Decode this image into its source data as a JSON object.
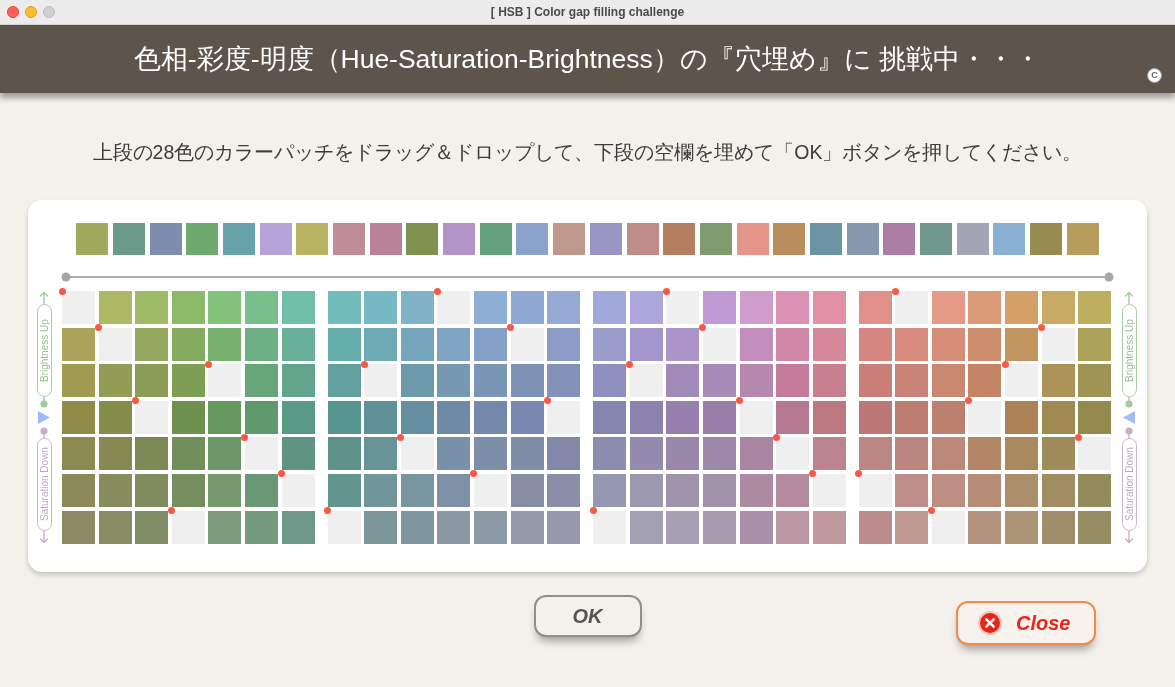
{
  "window": {
    "title": "[ HSB ] Color gap filling challenge"
  },
  "header": {
    "title": "色相-彩度-明度（Hue-Saturation-Brightness）の『穴埋め』に 挑戦中・・・",
    "badge": "C"
  },
  "instruction": "上段の28色のカラーパッチをドラッグ＆ドロップして、下段の空欄を埋めて「OK」ボタンを押してください。",
  "palette": [
    {
      "color": "#a0aa5e"
    },
    {
      "color": "#6a9a8a"
    },
    {
      "color": "#7e8cb0"
    },
    {
      "color": "#6eaa70"
    },
    {
      "color": "#68a2aa"
    },
    {
      "color": "#b4a2d8"
    },
    {
      "color": "#b8b462"
    },
    {
      "color": "#be8c94"
    },
    {
      "color": "#b88298"
    },
    {
      "color": "#7c924e"
    },
    {
      "color": "#b294c8"
    },
    {
      "color": "#64a07c"
    },
    {
      "color": "#8aa2ca"
    },
    {
      "color": "#be988c"
    },
    {
      "color": "#9a94c4"
    },
    {
      "color": "#be8c8a"
    },
    {
      "color": "#b47e60"
    },
    {
      "color": "#7e9a6e"
    },
    {
      "color": "#e4968a"
    },
    {
      "color": "#b88e5c"
    },
    {
      "color": "#6c94a4"
    },
    {
      "color": "#8698ae"
    },
    {
      "color": "#ac7ea6"
    },
    {
      "color": "#70988e"
    },
    {
      "color": "#a4a4b4"
    },
    {
      "color": "#8ab0d4"
    },
    {
      "color": "#968c50"
    },
    {
      "color": "#b89e5c"
    }
  ],
  "left_axis": {
    "upper": "Brightness Up",
    "lower": "Saturation Down"
  },
  "right_axis": {
    "upper": "Brightness Up",
    "lower": "Saturation Down"
  },
  "grid": {
    "blocks": [
      {
        "rows": [
          [
            {
              "kind": "empty"
            },
            {
              "kind": "patch",
              "color": "#adb865"
            },
            {
              "kind": "patch",
              "color": "#9fba65"
            },
            {
              "kind": "patch",
              "color": "#8dba68"
            },
            {
              "kind": "patch",
              "color": "#82c27a"
            },
            {
              "kind": "patch",
              "color": "#77c08c"
            },
            {
              "kind": "patch",
              "color": "#6fc0a6"
            }
          ],
          [
            {
              "kind": "patch",
              "color": "#aba45a"
            },
            {
              "kind": "empty"
            },
            {
              "kind": "patch",
              "color": "#93a85c"
            },
            {
              "kind": "patch",
              "color": "#85ab60"
            },
            {
              "kind": "patch",
              "color": "#78b070"
            },
            {
              "kind": "patch",
              "color": "#6db083"
            },
            {
              "kind": "patch",
              "color": "#68b09a"
            }
          ],
          [
            {
              "kind": "patch",
              "color": "#a09a52"
            },
            {
              "kind": "patch",
              "color": "#929c52"
            },
            {
              "kind": "patch",
              "color": "#8a9c55"
            },
            {
              "kind": "patch",
              "color": "#7c9e55"
            },
            {
              "kind": "empty"
            },
            {
              "kind": "patch",
              "color": "#66a678"
            },
            {
              "kind": "patch",
              "color": "#62a48c"
            }
          ],
          [
            {
              "kind": "patch",
              "color": "#8e8a48"
            },
            {
              "kind": "patch",
              "color": "#848c4a"
            },
            {
              "kind": "empty"
            },
            {
              "kind": "patch",
              "color": "#6e9150"
            },
            {
              "kind": "patch",
              "color": "#66985f"
            },
            {
              "kind": "patch",
              "color": "#5e9a6e"
            },
            {
              "kind": "patch",
              "color": "#589a86"
            }
          ],
          [
            {
              "kind": "patch",
              "color": "#8c8a50"
            },
            {
              "kind": "patch",
              "color": "#868a52"
            },
            {
              "kind": "patch",
              "color": "#7e8a56"
            },
            {
              "kind": "patch",
              "color": "#728e5a"
            },
            {
              "kind": "patch",
              "color": "#6c9668"
            },
            {
              "kind": "empty"
            },
            {
              "kind": "patch",
              "color": "#609482"
            }
          ],
          [
            {
              "kind": "patch",
              "color": "#8c8a5a"
            },
            {
              "kind": "patch",
              "color": "#868c5c"
            },
            {
              "kind": "patch",
              "color": "#808c5e"
            },
            {
              "kind": "patch",
              "color": "#768e5e"
            },
            {
              "kind": "patch",
              "color": "#76986e"
            },
            {
              "kind": "patch",
              "color": "#6a9876"
            },
            {
              "kind": "empty"
            }
          ],
          [
            {
              "kind": "patch",
              "color": "#8c8a62"
            },
            {
              "kind": "patch",
              "color": "#888c64"
            },
            {
              "kind": "patch",
              "color": "#808e66"
            },
            {
              "kind": "empty"
            },
            {
              "kind": "patch",
              "color": "#7c9a7a"
            },
            {
              "kind": "patch",
              "color": "#749a80"
            },
            {
              "kind": "patch",
              "color": "#70988a"
            }
          ]
        ]
      },
      {
        "rows": [
          [
            {
              "kind": "patch",
              "color": "#72bcbc"
            },
            {
              "kind": "patch",
              "color": "#76b8c4"
            },
            {
              "kind": "patch",
              "color": "#80b2c8"
            },
            {
              "kind": "empty"
            },
            {
              "kind": "patch",
              "color": "#8eaed4"
            },
            {
              "kind": "patch",
              "color": "#90a8d4"
            },
            {
              "kind": "patch",
              "color": "#96a8d4"
            }
          ],
          [
            {
              "kind": "patch",
              "color": "#66aeac"
            },
            {
              "kind": "patch",
              "color": "#6eaab4"
            },
            {
              "kind": "patch",
              "color": "#76a6bc"
            },
            {
              "kind": "patch",
              "color": "#80a4c4"
            },
            {
              "kind": "patch",
              "color": "#84a0c6"
            },
            {
              "kind": "empty"
            },
            {
              "kind": "patch",
              "color": "#8c9cc6"
            }
          ],
          [
            {
              "kind": "patch",
              "color": "#62a0a0"
            },
            {
              "kind": "empty"
            },
            {
              "kind": "patch",
              "color": "#6c9aaa"
            },
            {
              "kind": "patch",
              "color": "#7698b2"
            },
            {
              "kind": "patch",
              "color": "#7a96b6"
            },
            {
              "kind": "patch",
              "color": "#7e92b6"
            },
            {
              "kind": "patch",
              "color": "#8492ba"
            }
          ],
          [
            {
              "kind": "patch",
              "color": "#579690"
            },
            {
              "kind": "patch",
              "color": "#5e9298"
            },
            {
              "kind": "patch",
              "color": "#658fa0"
            },
            {
              "kind": "patch",
              "color": "#6e8aa6"
            },
            {
              "kind": "patch",
              "color": "#7488aa"
            },
            {
              "kind": "patch",
              "color": "#7787ad"
            },
            {
              "kind": "empty"
            }
          ],
          [
            {
              "kind": "patch",
              "color": "#5e9288"
            },
            {
              "kind": "patch",
              "color": "#689496"
            },
            {
              "kind": "empty"
            },
            {
              "kind": "patch",
              "color": "#7890a8"
            },
            {
              "kind": "patch",
              "color": "#7c8ea8"
            },
            {
              "kind": "patch",
              "color": "#7e8ca6"
            },
            {
              "kind": "patch",
              "color": "#8488a8"
            }
          ],
          [
            {
              "kind": "patch",
              "color": "#64948e"
            },
            {
              "kind": "patch",
              "color": "#70969a"
            },
            {
              "kind": "patch",
              "color": "#7896a0"
            },
            {
              "kind": "patch",
              "color": "#7e90a6"
            },
            {
              "kind": "empty"
            },
            {
              "kind": "patch",
              "color": "#888ea4"
            },
            {
              "kind": "patch",
              "color": "#8c8ea8"
            }
          ],
          [
            {
              "kind": "empty"
            },
            {
              "kind": "patch",
              "color": "#7a9698"
            },
            {
              "kind": "patch",
              "color": "#8096a0"
            },
            {
              "kind": "patch",
              "color": "#8a98a4"
            },
            {
              "kind": "patch",
              "color": "#8c9aa6"
            },
            {
              "kind": "patch",
              "color": "#9498a8"
            },
            {
              "kind": "patch",
              "color": "#9898ac"
            }
          ]
        ]
      },
      {
        "rows": [
          [
            {
              "kind": "patch",
              "color": "#a0a8dc"
            },
            {
              "kind": "patch",
              "color": "#aca6dc"
            },
            {
              "kind": "empty"
            },
            {
              "kind": "patch",
              "color": "#c09ad4"
            },
            {
              "kind": "patch",
              "color": "#d09ccc"
            },
            {
              "kind": "patch",
              "color": "#dc90b4"
            },
            {
              "kind": "patch",
              "color": "#e290a4"
            }
          ],
          [
            {
              "kind": "patch",
              "color": "#9a9ccc"
            },
            {
              "kind": "patch",
              "color": "#a296cc"
            },
            {
              "kind": "patch",
              "color": "#aa94c8"
            },
            {
              "kind": "empty"
            },
            {
              "kind": "patch",
              "color": "#c28cbc"
            },
            {
              "kind": "patch",
              "color": "#d086a4"
            },
            {
              "kind": "patch",
              "color": "#d48898"
            }
          ],
          [
            {
              "kind": "patch",
              "color": "#8e90c0"
            },
            {
              "kind": "empty"
            },
            {
              "kind": "patch",
              "color": "#a08ab8"
            },
            {
              "kind": "patch",
              "color": "#a68ab8"
            },
            {
              "kind": "patch",
              "color": "#b688b0"
            },
            {
              "kind": "patch",
              "color": "#c47c9a"
            },
            {
              "kind": "patch",
              "color": "#c8808e"
            }
          ],
          [
            {
              "kind": "patch",
              "color": "#8486b0"
            },
            {
              "kind": "patch",
              "color": "#8c82b0"
            },
            {
              "kind": "patch",
              "color": "#9680ae"
            },
            {
              "kind": "patch",
              "color": "#9a7ea8"
            },
            {
              "kind": "empty"
            },
            {
              "kind": "patch",
              "color": "#b47890"
            },
            {
              "kind": "patch",
              "color": "#bc7880"
            }
          ],
          [
            {
              "kind": "patch",
              "color": "#8c8cb0"
            },
            {
              "kind": "patch",
              "color": "#948aae"
            },
            {
              "kind": "patch",
              "color": "#9a88aa"
            },
            {
              "kind": "patch",
              "color": "#9c88a8"
            },
            {
              "kind": "patch",
              "color": "#a886a2"
            },
            {
              "kind": "empty"
            },
            {
              "kind": "patch",
              "color": "#bc848e"
            }
          ],
          [
            {
              "kind": "patch",
              "color": "#9498b0"
            },
            {
              "kind": "patch",
              "color": "#9c98b0"
            },
            {
              "kind": "patch",
              "color": "#a094ac"
            },
            {
              "kind": "patch",
              "color": "#a292aa"
            },
            {
              "kind": "patch",
              "color": "#ac8aa2"
            },
            {
              "kind": "patch",
              "color": "#b48a9e"
            },
            {
              "kind": "empty"
            }
          ],
          [
            {
              "kind": "empty"
            },
            {
              "kind": "patch",
              "color": "#a4a0b4"
            },
            {
              "kind": "patch",
              "color": "#a6a0b2"
            },
            {
              "kind": "patch",
              "color": "#a69aac"
            },
            {
              "kind": "patch",
              "color": "#aa90a6"
            },
            {
              "kind": "patch",
              "color": "#ba96a2"
            },
            {
              "kind": "patch",
              "color": "#c09a9c"
            }
          ]
        ]
      },
      {
        "rows": [
          [
            {
              "kind": "patch",
              "color": "#e2908c"
            },
            {
              "kind": "empty"
            },
            {
              "kind": "patch",
              "color": "#e49a86"
            },
            {
              "kind": "patch",
              "color": "#da9c76"
            },
            {
              "kind": "patch",
              "color": "#d4a068"
            },
            {
              "kind": "patch",
              "color": "#c8aa64"
            },
            {
              "kind": "patch",
              "color": "#bcb060"
            }
          ],
          [
            {
              "kind": "patch",
              "color": "#d68680"
            },
            {
              "kind": "patch",
              "color": "#d68a7e"
            },
            {
              "kind": "patch",
              "color": "#d68e78"
            },
            {
              "kind": "patch",
              "color": "#cc8e6c"
            },
            {
              "kind": "patch",
              "color": "#c29560"
            },
            {
              "kind": "empty"
            },
            {
              "kind": "patch",
              "color": "#aca25a"
            }
          ],
          [
            {
              "kind": "patch",
              "color": "#ca7e7a"
            },
            {
              "kind": "patch",
              "color": "#c88276"
            },
            {
              "kind": "patch",
              "color": "#c88872"
            },
            {
              "kind": "patch",
              "color": "#c48466"
            },
            {
              "kind": "empty"
            },
            {
              "kind": "patch",
              "color": "#ac9458"
            },
            {
              "kind": "patch",
              "color": "#a09454"
            }
          ],
          [
            {
              "kind": "patch",
              "color": "#bc7876"
            },
            {
              "kind": "patch",
              "color": "#bc7c70"
            },
            {
              "kind": "patch",
              "color": "#bc806e"
            },
            {
              "kind": "empty"
            },
            {
              "kind": "patch",
              "color": "#aa8256"
            },
            {
              "kind": "patch",
              "color": "#a08a52"
            },
            {
              "kind": "patch",
              "color": "#948a4e"
            }
          ],
          [
            {
              "kind": "patch",
              "color": "#bc8684"
            },
            {
              "kind": "patch",
              "color": "#bc8680"
            },
            {
              "kind": "patch",
              "color": "#bc887a"
            },
            {
              "kind": "patch",
              "color": "#b48668"
            },
            {
              "kind": "patch",
              "color": "#a88a5e"
            },
            {
              "kind": "patch",
              "color": "#a08c5a"
            },
            {
              "kind": "empty"
            }
          ],
          [
            {
              "kind": "empty"
            },
            {
              "kind": "patch",
              "color": "#be8e8a"
            },
            {
              "kind": "patch",
              "color": "#bc8e84"
            },
            {
              "kind": "patch",
              "color": "#b68c76"
            },
            {
              "kind": "patch",
              "color": "#ac8e6c"
            },
            {
              "kind": "patch",
              "color": "#a08e62"
            },
            {
              "kind": "patch",
              "color": "#928c5a"
            }
          ],
          [
            {
              "kind": "patch",
              "color": "#bc8c8c"
            },
            {
              "kind": "patch",
              "color": "#be9890"
            },
            {
              "kind": "empty"
            },
            {
              "kind": "patch",
              "color": "#b49280"
            },
            {
              "kind": "patch",
              "color": "#ac9476"
            },
            {
              "kind": "patch",
              "color": "#a08e6a"
            },
            {
              "kind": "patch",
              "color": "#968e62"
            }
          ]
        ]
      }
    ]
  },
  "buttons": [
    {
      "kind": "ok",
      "label": "OK"
    },
    {
      "kind": "close",
      "label": "Close"
    }
  ]
}
